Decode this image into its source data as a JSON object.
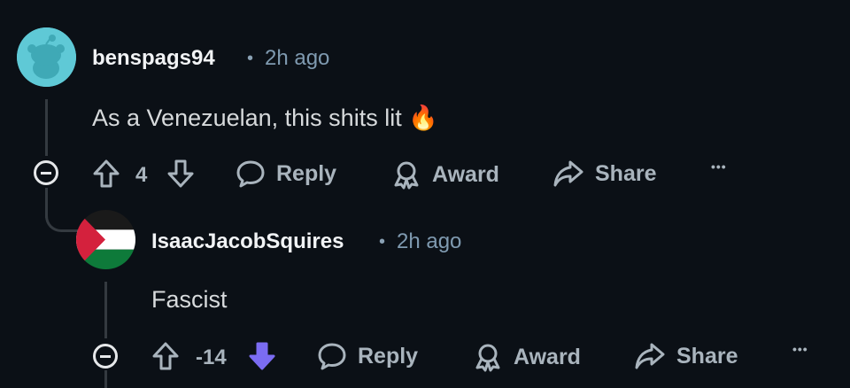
{
  "comments": [
    {
      "username": "benspags94",
      "separator": "•",
      "time": "2h ago",
      "body": "As a Venezuelan, this shits lit 🔥",
      "score": "4",
      "actions": {
        "reply": "Reply",
        "award": "Award",
        "share": "Share",
        "more": "•••"
      }
    },
    {
      "username": "IsaacJacobSquires",
      "separator": "•",
      "time": "2h ago",
      "body": "Fascist",
      "score": "-14",
      "actions": {
        "reply": "Reply",
        "award": "Award",
        "share": "Share",
        "more": "•••"
      }
    }
  ],
  "colors": {
    "background": "#0b1016",
    "downvote_active": "#7b6cf2",
    "avatar_teal": "#5fc9d6"
  },
  "icons": [
    "snoo-avatar-icon",
    "palestine-flag-avatar",
    "collapse-icon",
    "upvote-icon",
    "downvote-icon",
    "reply-icon",
    "award-icon",
    "share-icon",
    "more-icon"
  ]
}
